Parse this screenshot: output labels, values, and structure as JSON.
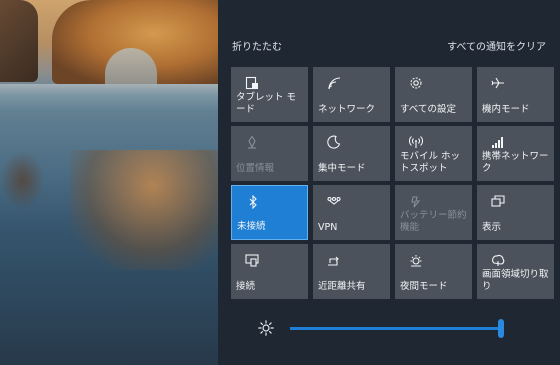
{
  "panel": {
    "collapse_label": "折りたたむ",
    "clear_all_label": "すべての通知をクリア"
  },
  "tiles": [
    {
      "label": "タブレット モード",
      "icon": "tablet-mode-icon",
      "state": "off"
    },
    {
      "label": "ネットワーク",
      "icon": "network-icon",
      "state": "off"
    },
    {
      "label": "すべての設定",
      "icon": "gear-icon",
      "state": "off"
    },
    {
      "label": "機内モード",
      "icon": "airplane-icon",
      "state": "off"
    },
    {
      "label": "位置情報",
      "icon": "location-icon",
      "state": "disabled"
    },
    {
      "label": "集中モード",
      "icon": "moon-icon",
      "state": "off"
    },
    {
      "label": "モバイル ホットスポット",
      "icon": "hotspot-icon",
      "state": "off"
    },
    {
      "label": "携帯ネットワーク",
      "icon": "cellular-icon",
      "state": "off"
    },
    {
      "label": "未接続",
      "icon": "bluetooth-icon",
      "state": "on"
    },
    {
      "label": "VPN",
      "icon": "vpn-icon",
      "state": "off"
    },
    {
      "label": "バッテリー節約機能",
      "icon": "battery-saver-icon",
      "state": "disabled"
    },
    {
      "label": "表示",
      "icon": "project-icon",
      "state": "off"
    },
    {
      "label": "接続",
      "icon": "connect-icon",
      "state": "off"
    },
    {
      "label": "近距離共有",
      "icon": "nearby-share-icon",
      "state": "off"
    },
    {
      "label": "夜間モード",
      "icon": "night-light-icon",
      "state": "off"
    },
    {
      "label": "画面領域切り取り",
      "icon": "snip-icon",
      "state": "off"
    }
  ],
  "brightness": {
    "icon": "brightness-icon",
    "level_percent": 100
  },
  "colors": {
    "accent": "#1f7fd4",
    "tile": "#4b525c",
    "panel": "#1f2733"
  }
}
